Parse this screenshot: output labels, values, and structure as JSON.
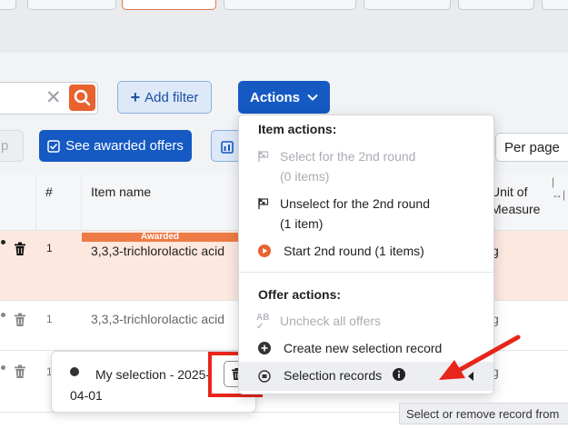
{
  "toolbar": {
    "add_filter_label": "Add filter",
    "actions_label": "Actions",
    "ghost_button_label": "p",
    "awarded_offers_label": "See awarded offers",
    "per_page_label": "Per page"
  },
  "table": {
    "headers": {
      "number": "#",
      "item_name": "Item name",
      "unit_line1": "Unit of",
      "unit_line2": "Measure"
    },
    "rows": [
      {
        "number": "1",
        "item_name": "3,3,3-trichlorolactic acid",
        "unit": "kg",
        "badge": "Awarded"
      },
      {
        "number": "1",
        "item_name": "3,3,3-trichlorolactic acid",
        "unit": "kg"
      },
      {
        "number": "1",
        "unit": "kg"
      }
    ]
  },
  "selection_popover": {
    "text": "My selection - 2025-04-01"
  },
  "actions_menu": {
    "item_actions_header": "Item actions:",
    "select_2nd_round": "Select for the 2nd round",
    "select_2nd_round_count": "(0 items)",
    "unselect_2nd_round": "Unselect for the 2nd round",
    "unselect_2nd_round_count": "(1 item)",
    "start_2nd_round": "Start 2nd round (1 items)",
    "offer_actions_header": "Offer actions:",
    "uncheck_all_offers": "Uncheck all offers",
    "create_selection_record": "Create new selection record",
    "selection_records": "Selection records"
  },
  "tooltip": {
    "text": "Select or remove record from"
  },
  "colors": {
    "primary": "#1559c3",
    "accent": "#e8622f",
    "awarded_row": "#fde8e0",
    "highlight_red": "#e8251a"
  }
}
